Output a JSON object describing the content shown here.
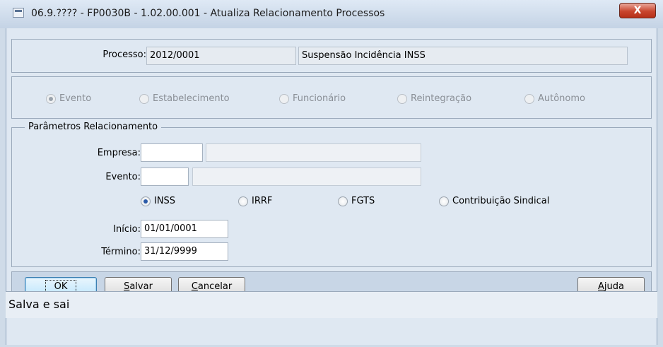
{
  "window": {
    "title": "06.9.???? - FP0030B - 1.02.00.001 - Atualiza Relacionamento Processos",
    "close_label": "X"
  },
  "processo": {
    "label": "Processo:",
    "code": "2012/0001",
    "description": "Suspensão Incidência INSS"
  },
  "tipo": {
    "options": [
      {
        "label": "Evento",
        "checked": true
      },
      {
        "label": "Estabelecimento",
        "checked": false
      },
      {
        "label": "Funcionário",
        "checked": false
      },
      {
        "label": "Reintegração",
        "checked": false
      },
      {
        "label": "Autônomo",
        "checked": false
      }
    ]
  },
  "parametros": {
    "title": "Parâmetros Relacionamento",
    "empresa_label": "Empresa:",
    "empresa_code": "",
    "empresa_desc": "",
    "evento_label": "Evento:",
    "evento_code": "",
    "evento_desc": "",
    "tributos": [
      {
        "label": "INSS",
        "checked": true
      },
      {
        "label": "IRRF",
        "checked": false
      },
      {
        "label": "FGTS",
        "checked": false
      },
      {
        "label": "Contribuição Sindical",
        "checked": false
      }
    ],
    "inicio_label": "Início:",
    "inicio_value": "01/01/0001",
    "termino_label": "Término:",
    "termino_value": "31/12/9999"
  },
  "buttons": {
    "ok": "OK",
    "salvar_underline": "S",
    "salvar_rest": "alvar",
    "cancelar_underline": "C",
    "cancelar_rest": "ancelar",
    "ajuda_underline": "A",
    "ajuda_rest": "juda"
  },
  "status": {
    "text": "Salva e sai"
  }
}
